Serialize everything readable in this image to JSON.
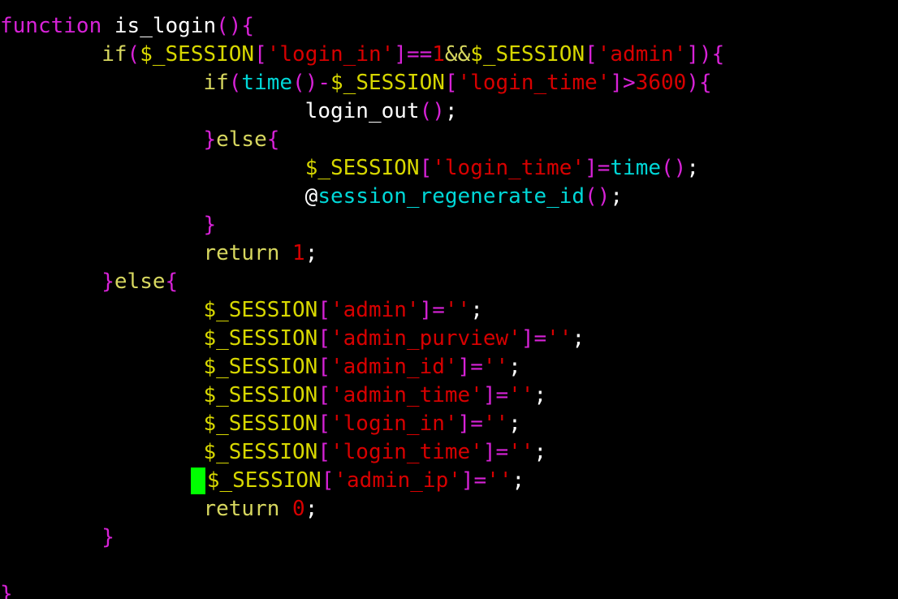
{
  "editor": {
    "colors": {
      "background": "#000000",
      "keyword": "#d722d7",
      "variable": "#d7d700",
      "string": "#d70000",
      "function": "#00d7d7",
      "plain": "#ffffff",
      "cursor": "#00ff00"
    },
    "cursor_line": 16,
    "lines": [
      {
        "tokens": [
          [
            "kw",
            "function"
          ],
          [
            "plain",
            " is_login"
          ],
          [
            "punct",
            "(){"
          ]
        ]
      },
      {
        "tokens": [
          [
            "plain",
            "        "
          ],
          [
            "ctl",
            "if"
          ],
          [
            "punct",
            "("
          ],
          [
            "var",
            "$_SESSION"
          ],
          [
            "punct",
            "["
          ],
          [
            "str",
            "'login_in'"
          ],
          [
            "punct",
            "]=="
          ],
          [
            "num",
            "1"
          ],
          [
            "ctl",
            "&&"
          ],
          [
            "var",
            "$_SESSION"
          ],
          [
            "punct",
            "["
          ],
          [
            "str",
            "'admin'"
          ],
          [
            "punct",
            "]){"
          ]
        ]
      },
      {
        "tokens": [
          [
            "plain",
            "                "
          ],
          [
            "ctl",
            "if"
          ],
          [
            "punct",
            "("
          ],
          [
            "func",
            "time"
          ],
          [
            "punct",
            "()-"
          ],
          [
            "var",
            "$_SESSION"
          ],
          [
            "punct",
            "["
          ],
          [
            "str",
            "'login_time'"
          ],
          [
            "punct",
            "]>"
          ],
          [
            "num",
            "3600"
          ],
          [
            "punct",
            "){"
          ]
        ]
      },
      {
        "tokens": [
          [
            "plain",
            "                        login_out"
          ],
          [
            "punct",
            "()"
          ],
          [
            "semi",
            ";"
          ]
        ]
      },
      {
        "tokens": [
          [
            "plain",
            "                "
          ],
          [
            "punct",
            "}"
          ],
          [
            "ctl",
            "else"
          ],
          [
            "punct",
            "{"
          ]
        ]
      },
      {
        "tokens": [
          [
            "plain",
            "                        "
          ],
          [
            "var",
            "$_SESSION"
          ],
          [
            "punct",
            "["
          ],
          [
            "str",
            "'login_time'"
          ],
          [
            "punct",
            "]="
          ],
          [
            "func",
            "time"
          ],
          [
            "punct",
            "()"
          ],
          [
            "semi",
            ";"
          ]
        ]
      },
      {
        "tokens": [
          [
            "plain",
            "                        @"
          ],
          [
            "func",
            "session_regenerate_id"
          ],
          [
            "punct",
            "()"
          ],
          [
            "semi",
            ";"
          ]
        ]
      },
      {
        "tokens": [
          [
            "plain",
            "                "
          ],
          [
            "punct",
            "}"
          ]
        ]
      },
      {
        "tokens": [
          [
            "plain",
            "                "
          ],
          [
            "ctl",
            "return"
          ],
          [
            "plain",
            " "
          ],
          [
            "num",
            "1"
          ],
          [
            "semi",
            ";"
          ]
        ]
      },
      {
        "tokens": [
          [
            "plain",
            "        "
          ],
          [
            "punct",
            "}"
          ],
          [
            "ctl",
            "else"
          ],
          [
            "punct",
            "{"
          ]
        ]
      },
      {
        "tokens": [
          [
            "plain",
            "                "
          ],
          [
            "var",
            "$_SESSION"
          ],
          [
            "punct",
            "["
          ],
          [
            "str",
            "'admin'"
          ],
          [
            "punct",
            "]="
          ],
          [
            "str",
            "''"
          ],
          [
            "semi",
            ";"
          ]
        ]
      },
      {
        "tokens": [
          [
            "plain",
            "                "
          ],
          [
            "var",
            "$_SESSION"
          ],
          [
            "punct",
            "["
          ],
          [
            "str",
            "'admin_purview'"
          ],
          [
            "punct",
            "]="
          ],
          [
            "str",
            "''"
          ],
          [
            "semi",
            ";"
          ]
        ]
      },
      {
        "tokens": [
          [
            "plain",
            "                "
          ],
          [
            "var",
            "$_SESSION"
          ],
          [
            "punct",
            "["
          ],
          [
            "str",
            "'admin_id'"
          ],
          [
            "punct",
            "]="
          ],
          [
            "str",
            "''"
          ],
          [
            "semi",
            ";"
          ]
        ]
      },
      {
        "tokens": [
          [
            "plain",
            "                "
          ],
          [
            "var",
            "$_SESSION"
          ],
          [
            "punct",
            "["
          ],
          [
            "str",
            "'admin_time'"
          ],
          [
            "punct",
            "]="
          ],
          [
            "str",
            "''"
          ],
          [
            "semi",
            ";"
          ]
        ]
      },
      {
        "tokens": [
          [
            "plain",
            "                "
          ],
          [
            "var",
            "$_SESSION"
          ],
          [
            "punct",
            "["
          ],
          [
            "str",
            "'login_in'"
          ],
          [
            "punct",
            "]="
          ],
          [
            "str",
            "''"
          ],
          [
            "semi",
            ";"
          ]
        ]
      },
      {
        "tokens": [
          [
            "plain",
            "                "
          ],
          [
            "var",
            "$_SESSION"
          ],
          [
            "punct",
            "["
          ],
          [
            "str",
            "'login_time'"
          ],
          [
            "punct",
            "]="
          ],
          [
            "str",
            "''"
          ],
          [
            "semi",
            ";"
          ]
        ]
      },
      {
        "tokens": [
          [
            "plain",
            "               "
          ],
          [
            "cursor",
            ""
          ],
          [
            "var",
            "$_SESSION"
          ],
          [
            "punct",
            "["
          ],
          [
            "str",
            "'admin_ip'"
          ],
          [
            "punct",
            "]="
          ],
          [
            "str",
            "''"
          ],
          [
            "semi",
            ";"
          ]
        ]
      },
      {
        "tokens": [
          [
            "plain",
            "                "
          ],
          [
            "ctl",
            "return"
          ],
          [
            "plain",
            " "
          ],
          [
            "num",
            "0"
          ],
          [
            "semi",
            ";"
          ]
        ]
      },
      {
        "tokens": [
          [
            "plain",
            "        "
          ],
          [
            "punct",
            "}"
          ]
        ]
      },
      {
        "tokens": [
          [
            "plain",
            ""
          ]
        ]
      },
      {
        "tokens": [
          [
            "punct",
            "}"
          ]
        ]
      }
    ]
  }
}
